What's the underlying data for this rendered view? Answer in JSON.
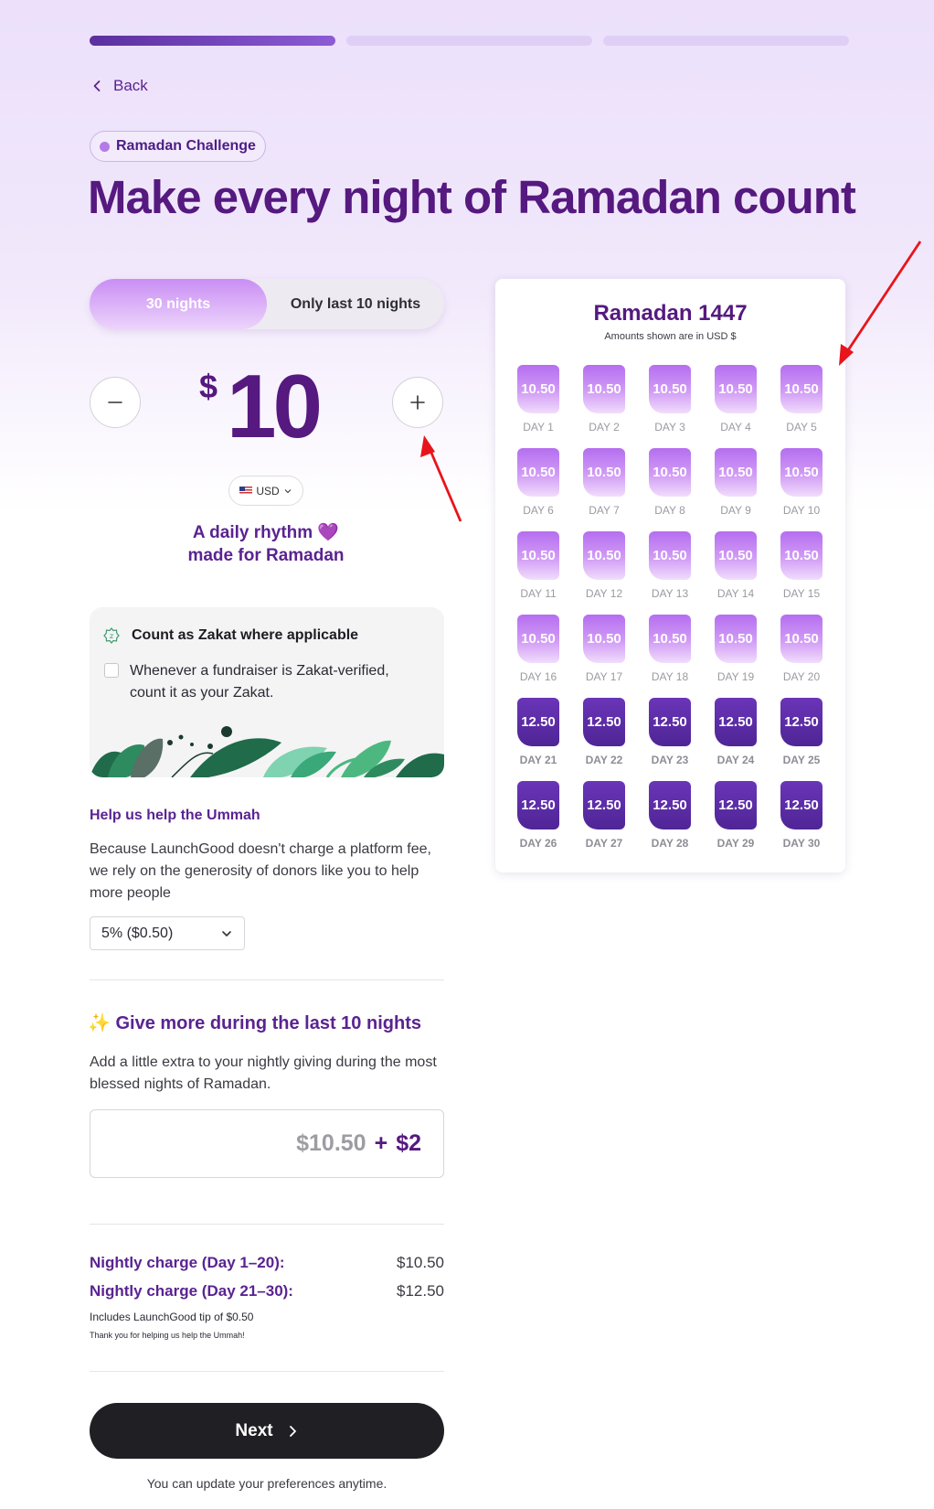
{
  "progress": {
    "steps": 3,
    "current": 1
  },
  "nav": {
    "back_label": "Back"
  },
  "badge": {
    "label": "Ramadan Challenge"
  },
  "page_title": "Make every night of Ramadan count",
  "plan_toggle": {
    "options": [
      "30 nights",
      "Only last 10 nights"
    ],
    "selected": "30 nights"
  },
  "amount": {
    "currency_symbol": "$",
    "value": "10"
  },
  "currency_select": {
    "value": "USD"
  },
  "rhythm": {
    "line1": "A daily rhythm 💜",
    "line2": "made for Ramadan"
  },
  "zakat": {
    "title": "Count as Zakat where applicable",
    "description": "Whenever a fundraiser is Zakat-verified, count it as your Zakat."
  },
  "help": {
    "title": "Help us help the Ummah",
    "description": "Because LaunchGood doesn't charge a platform fee, we rely on the generosity of donors like you to help more people",
    "tip_select": "5% ($0.50)"
  },
  "give_more": {
    "title": "✨ Give more during the last 10 nights",
    "description": "Add a little extra to your nightly giving during the most blessed nights of Ramadan.",
    "base": "$10.50",
    "plus": "+",
    "extra": "$2"
  },
  "summary": {
    "row1_label": "Nightly charge (Day 1–20):",
    "row1_value": "$10.50",
    "row2_label": "Nightly charge (Day 21–30):",
    "row2_value": "$12.50",
    "tip_note": "Includes LaunchGood tip of $0.50",
    "thanks": "Thank you for helping us help the Ummah!"
  },
  "next_label": "Next",
  "footnote": "You can update your preferences anytime.",
  "calendar": {
    "title": "Ramadan 1447",
    "subtitle": "Amounts shown are in USD $",
    "days": [
      {
        "label": "DAY 1",
        "amount": "10.50"
      },
      {
        "label": "DAY 2",
        "amount": "10.50"
      },
      {
        "label": "DAY 3",
        "amount": "10.50"
      },
      {
        "label": "DAY 4",
        "amount": "10.50"
      },
      {
        "label": "DAY 5",
        "amount": "10.50"
      },
      {
        "label": "DAY 6",
        "amount": "10.50"
      },
      {
        "label": "DAY 7",
        "amount": "10.50"
      },
      {
        "label": "DAY 8",
        "amount": "10.50"
      },
      {
        "label": "DAY 9",
        "amount": "10.50"
      },
      {
        "label": "DAY 10",
        "amount": "10.50"
      },
      {
        "label": "DAY 11",
        "amount": "10.50"
      },
      {
        "label": "DAY 12",
        "amount": "10.50"
      },
      {
        "label": "DAY 13",
        "amount": "10.50"
      },
      {
        "label": "DAY 14",
        "amount": "10.50"
      },
      {
        "label": "DAY 15",
        "amount": "10.50"
      },
      {
        "label": "DAY 16",
        "amount": "10.50"
      },
      {
        "label": "DAY 17",
        "amount": "10.50"
      },
      {
        "label": "DAY 18",
        "amount": "10.50"
      },
      {
        "label": "DAY 19",
        "amount": "10.50"
      },
      {
        "label": "DAY 20",
        "amount": "10.50"
      },
      {
        "label": "DAY 21",
        "amount": "12.50"
      },
      {
        "label": "DAY 22",
        "amount": "12.50"
      },
      {
        "label": "DAY 23",
        "amount": "12.50"
      },
      {
        "label": "DAY 24",
        "amount": "12.50"
      },
      {
        "label": "DAY 25",
        "amount": "12.50"
      },
      {
        "label": "DAY 26",
        "amount": "12.50"
      },
      {
        "label": "DAY 27",
        "amount": "12.50"
      },
      {
        "label": "DAY 28",
        "amount": "12.50"
      },
      {
        "label": "DAY 29",
        "amount": "12.50"
      },
      {
        "label": "DAY 30",
        "amount": "12.50"
      }
    ]
  },
  "icons": {
    "back": "chevron-left-icon",
    "minus": "minus-icon",
    "plus": "plus-icon",
    "dropdown": "chevron-down-icon",
    "next": "chevron-right-icon",
    "zakat": "zakat-badge-icon",
    "flag": "us-flag-icon"
  },
  "colors": {
    "brand_purple": "#55197f",
    "accent_light": "#c98ef3",
    "dark_button": "#1f1f24",
    "annotation_arrow": "#e8141b"
  }
}
